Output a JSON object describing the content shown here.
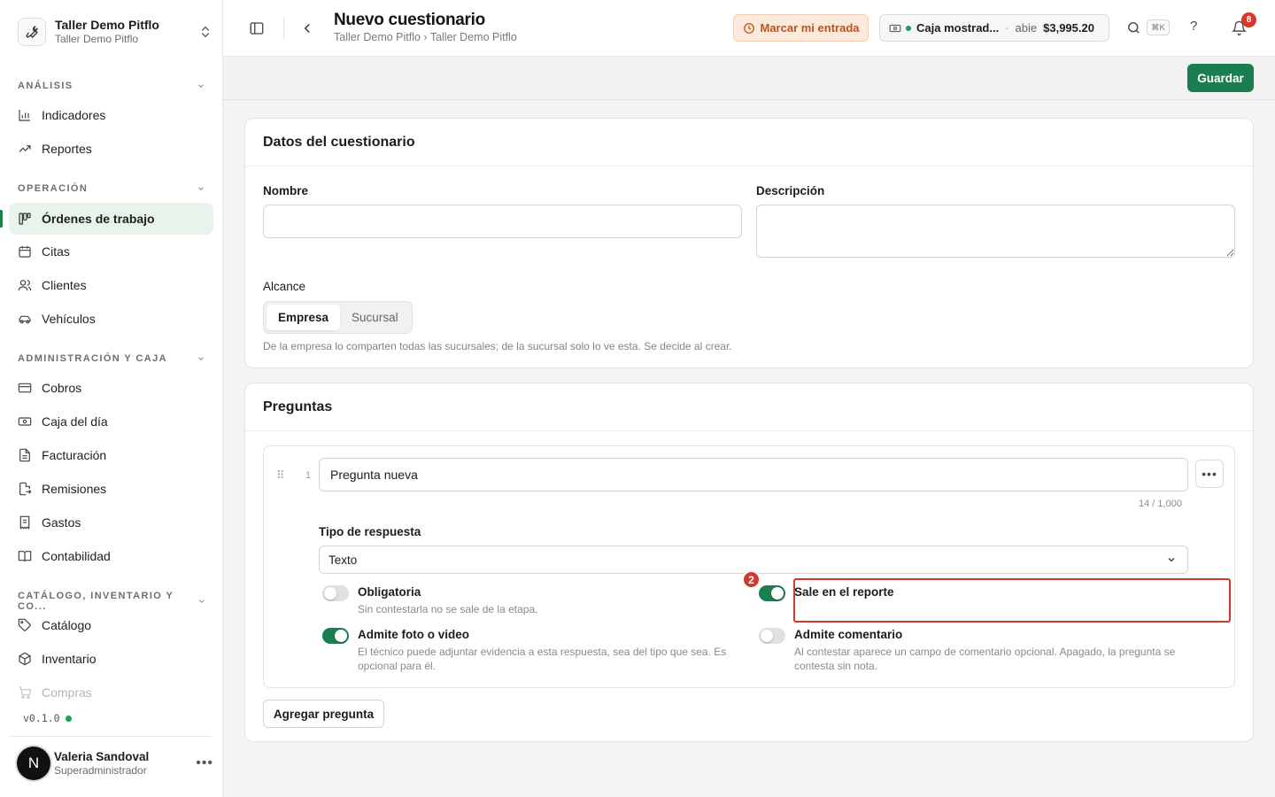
{
  "org": {
    "name": "Taller Demo Pitflo",
    "subtitle": "Taller Demo Pitflo"
  },
  "sidebar": {
    "sections": [
      {
        "title": "ANÁLISIS",
        "items": [
          {
            "label": "Indicadores",
            "icon": "bar-chart-icon"
          },
          {
            "label": "Reportes",
            "icon": "trending-up-icon"
          }
        ]
      },
      {
        "title": "OPERACIÓN",
        "items": [
          {
            "label": "Órdenes de trabajo",
            "icon": "kanban-icon",
            "active": true
          },
          {
            "label": "Citas",
            "icon": "calendar-icon"
          },
          {
            "label": "Clientes",
            "icon": "users-icon"
          },
          {
            "label": "Vehículos",
            "icon": "car-icon"
          }
        ]
      },
      {
        "title": "ADMINISTRACIÓN Y CAJA",
        "items": [
          {
            "label": "Cobros",
            "icon": "credit-card-icon"
          },
          {
            "label": "Caja del día",
            "icon": "banknote-icon"
          },
          {
            "label": "Facturación",
            "icon": "file-text-icon"
          },
          {
            "label": "Remisiones",
            "icon": "file-output-icon"
          },
          {
            "label": "Gastos",
            "icon": "receipt-icon"
          },
          {
            "label": "Contabilidad",
            "icon": "book-open-icon"
          }
        ]
      },
      {
        "title": "CATÁLOGO, INVENTARIO Y CO...",
        "items": [
          {
            "label": "Catálogo",
            "icon": "tag-icon"
          },
          {
            "label": "Inventario",
            "icon": "package-icon"
          },
          {
            "label": "Compras",
            "icon": "shopping-cart-icon"
          }
        ]
      }
    ],
    "version": "v0.1.0"
  },
  "user": {
    "initial": "N",
    "name": "Valeria Sandoval",
    "role": "Superadministrador"
  },
  "header": {
    "title": "Nuevo cuestionario",
    "breadcrumb": "Taller Demo Pitflo › Taller Demo Pitflo",
    "clock_in_label": "Marcar mi entrada",
    "register": {
      "name": "Caja mostrad...",
      "status": "abie",
      "amount": "$3,995.20"
    },
    "search_shortcut": "⌘K",
    "help_label": "?",
    "notifications_count": "8"
  },
  "actions": {
    "save_label": "Guardar"
  },
  "datos": {
    "title": "Datos del cuestionario",
    "name_label": "Nombre",
    "name_value": "",
    "description_label": "Descripción",
    "description_value": "",
    "scope_label": "Alcance",
    "scope_options": [
      "Empresa",
      "Sucursal"
    ],
    "scope_selected": "Empresa",
    "scope_hint": "De la empresa lo comparten todas las sucursales; de la sucursal solo lo ve esta. Se decide al crear."
  },
  "preguntas": {
    "title": "Preguntas",
    "question": {
      "number": "1",
      "text": "Pregunta nueva",
      "char_count": "14 / 1,000",
      "answer_type_label": "Tipo de respuesta",
      "answer_type_value": "Texto",
      "options": {
        "required": {
          "title": "Obligatoria",
          "desc": "Sin contestarla no se sale de la etapa.",
          "on": false
        },
        "in_report": {
          "title": "Sale en el reporte",
          "desc": "",
          "on": true
        },
        "media": {
          "title": "Admite foto o video",
          "desc": "El técnico puede adjuntar evidencia a esta respuesta, sea del tipo que sea. Es opcional para él.",
          "on": true
        },
        "comment": {
          "title": "Admite comentario",
          "desc": "Al contestar aparece un campo de comentario opcional. Apagado, la pregunta se contesta sin nota.",
          "on": false
        }
      }
    },
    "highlight_badge": "2",
    "add_label": "Agregar pregunta"
  },
  "colors": {
    "accent": "#1a7f4e",
    "highlight": "#d13a2e",
    "clock_in": "#b8541b"
  }
}
